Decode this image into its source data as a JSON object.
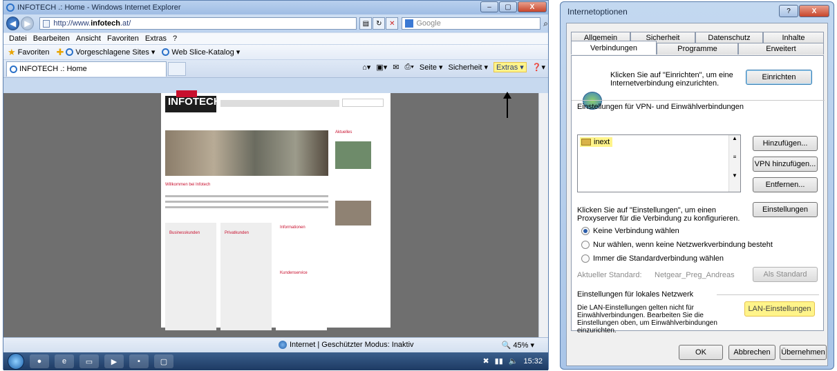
{
  "browser": {
    "window_title": "INFOTECH .: Home - Windows Internet Explorer",
    "address": {
      "prefix": "http://www.",
      "host": "infotech",
      "suffix": ".at/"
    },
    "search_placeholder": "Google",
    "menu": [
      "Datei",
      "Bearbeiten",
      "Ansicht",
      "Favoriten",
      "Extras",
      "?"
    ],
    "favorites": {
      "label": "Favoriten",
      "suggested": "Vorgeschlagene Sites ▾",
      "slice": "Web Slice-Katalog ▾"
    },
    "tab_title": "INFOTECH .: Home",
    "command_bar": {
      "seite": "Seite ▾",
      "sicherheit": "Sicherheit ▾",
      "extras": "Extras ▾",
      "help": "❓▾"
    },
    "page": {
      "logo": "INFOTECH",
      "welcome": "Willkommen bei Infotech",
      "box1": "Businesskunden",
      "box2": "Privatkunden",
      "box3": "Informationen",
      "box4": "Kundenservice",
      "side_title": "Aktuelles"
    },
    "status": {
      "text": "Internet | Geschützter Modus: Inaktiv",
      "zoom": "45%"
    },
    "clock": "15:32",
    "window_controls": {
      "minimize": "–",
      "maximize": "▢",
      "close": "X"
    }
  },
  "dialog": {
    "title": "Internetoptionen",
    "tabs_row1": [
      "Allgemein",
      "Sicherheit",
      "Datenschutz",
      "Inhalte"
    ],
    "tabs_row2": [
      "Verbindungen",
      "Programme",
      "Erweitert"
    ],
    "setup_text": "Klicken Sie auf \"Einrichten\", um eine Internetverbindung einzurichten.",
    "setup_button": "Einrichten",
    "vpn_heading": "Einstellungen für VPN- und Einwählverbindungen",
    "connection_item": "inext",
    "add_button": "Hinzufügen...",
    "add_vpn_button": "VPN hinzufügen...",
    "remove_button": "Entfernen...",
    "proxy_text": "Klicken Sie auf \"Einstellungen\", um einen Proxyserver für die Verbindung zu konfigurieren.",
    "settings_button": "Einstellungen",
    "radio_options": [
      {
        "label": "Keine Verbindung wählen",
        "checked": true
      },
      {
        "label": "Nur wählen, wenn keine Netzwerkverbindung besteht",
        "checked": false
      },
      {
        "label": "Immer die Standardverbindung wählen",
        "checked": false
      }
    ],
    "default_label": "Aktueller Standard:",
    "default_value": "Netgear_Preg_Andreas",
    "set_default_button": "Als Standard",
    "lan_heading": "Einstellungen für lokales Netzwerk",
    "lan_text": "Die LAN-Einstellungen gelten nicht für Einwählverbindungen. Bearbeiten Sie die Einstellungen oben, um Einwählverbindungen einzurichten.",
    "lan_button": "LAN-Einstellungen",
    "ok_button": "OK",
    "cancel_button": "Abbrechen",
    "apply_button": "Übernehmen",
    "help_button": "?",
    "close_button": "X"
  },
  "colors": {
    "highlight": "#fff48a",
    "brand_red": "#c8102e"
  }
}
